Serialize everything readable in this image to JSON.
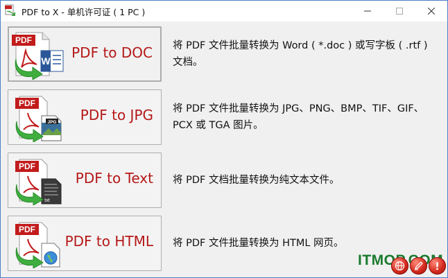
{
  "window": {
    "title": "PDF to X - 单机许可证 ( 1 PC )",
    "controls": [
      "minimize-icon",
      "maximize-icon",
      "close-icon"
    ]
  },
  "converters": [
    {
      "label": "PDF to DOC",
      "description": "将 PDF 文件批量转换为 Word ( *.doc ) 或写字板 ( .rtf ) 文档。",
      "icon": "pdf-to-doc-icon"
    },
    {
      "label": "PDF to JPG",
      "description": "将 PDF 文件批量转换为 JPG、PNG、BMP、TIF、GIF、PCX 或 TGA 图片。",
      "icon": "pdf-to-jpg-icon",
      "badge": "JPG"
    },
    {
      "label": "PDF to Text",
      "description": "将 PDF 文档批量转换为纯文本文件。",
      "icon": "pdf-to-text-icon",
      "badge": "txt"
    },
    {
      "label": "PDF to HTML",
      "description": "将 PDF 文件批量转换为 HTML 网页。",
      "icon": "pdf-to-html-icon"
    }
  ],
  "pdf_badge": "PDF",
  "watermark": "ITMOP.COM",
  "footer_buttons": [
    "globe-icon",
    "pen-icon",
    "help-icon"
  ],
  "colors": {
    "label_red": "#b51818",
    "watermark_green": "#1a7a2e",
    "window_border": "#4a7fc8"
  }
}
